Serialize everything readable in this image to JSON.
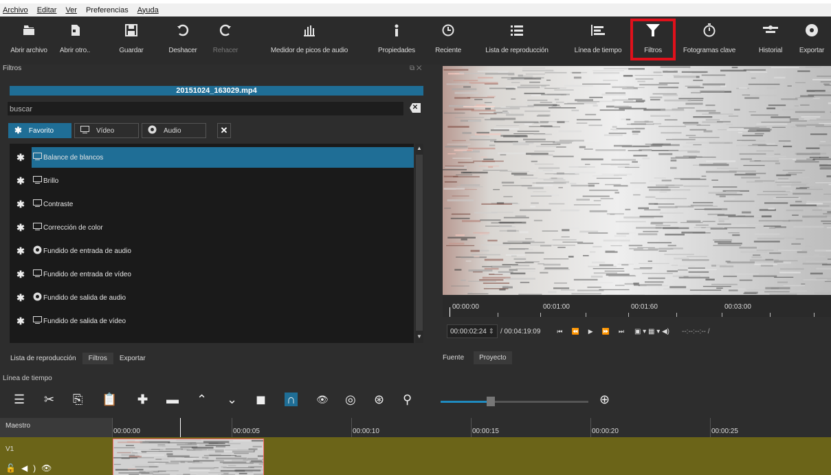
{
  "menu": [
    "Archivo",
    "Editar",
    "Ver",
    "Preferencias",
    "Ayuda"
  ],
  "toolbar": [
    {
      "label": "Abrir archivo",
      "icon": "open-file-icon"
    },
    {
      "label": "Abrir otro..",
      "icon": "open-other-icon"
    },
    {
      "label": "Guardar",
      "icon": "save-icon"
    },
    {
      "label": "Deshacer",
      "icon": "undo-icon"
    },
    {
      "label": "Rehacer",
      "icon": "redo-icon",
      "disabled": true
    },
    {
      "label": "Medidor de picos de audio",
      "icon": "audio-meter-icon"
    },
    {
      "label": "Propiedades",
      "icon": "info-icon"
    },
    {
      "label": "Reciente",
      "icon": "clock-icon"
    },
    {
      "label": "Lista de reproducción",
      "icon": "playlist-icon"
    },
    {
      "label": "Línea de tiempo",
      "icon": "timeline-icon"
    },
    {
      "label": "Filtros",
      "icon": "filter-icon",
      "highlighted": true
    },
    {
      "label": "Fotogramas clave",
      "icon": "stopwatch-icon"
    },
    {
      "label": "Historial",
      "icon": "history-icon"
    },
    {
      "label": "Exportar",
      "icon": "export-icon"
    }
  ],
  "filters_panel": {
    "title": "Filtros",
    "clip_name": "20151024_163029.mp4",
    "search_placeholder": "buscar",
    "tabs": [
      {
        "label": "Favorito",
        "icon": "star-icon",
        "active": true
      },
      {
        "label": "Vídeo",
        "icon": "monitor-icon"
      },
      {
        "label": "Audio",
        "icon": "speaker-icon"
      }
    ],
    "items": [
      {
        "label": "Balance de blancos",
        "type": "video",
        "selected": true
      },
      {
        "label": "Brillo",
        "type": "video"
      },
      {
        "label": "Contraste",
        "type": "video"
      },
      {
        "label": "Corrección de color",
        "type": "video"
      },
      {
        "label": "Fundido de entrada de audio",
        "type": "audio"
      },
      {
        "label": "Fundido de entrada de vídeo",
        "type": "video"
      },
      {
        "label": "Fundido de salida de audio",
        "type": "audio"
      },
      {
        "label": "Fundido de salida de vídeo",
        "type": "video"
      }
    ],
    "bottom_tabs": [
      "Lista de reproducción",
      "Filtros",
      "Exportar"
    ]
  },
  "viewer": {
    "ruler": [
      "00:00:00",
      "00:01:00",
      "00:01:60",
      "00:03:00"
    ],
    "position": "00:00:02:24",
    "duration": "/ 00:04:19:09",
    "in_out": "--:--:--:-- /",
    "tabs": [
      "Fuente",
      "Proyecto"
    ]
  },
  "timeline": {
    "title": "Línea de tiempo",
    "master_label": "Maestro",
    "track_label": "V1",
    "ruler": [
      "00:00:00",
      "00:00:05",
      "00:00:10",
      "00:00:15",
      "00:00:20",
      "00:00:25"
    ]
  },
  "colors": {
    "accent": "#1f6e96",
    "highlight": "#e0111b",
    "track": "#6b6418"
  }
}
